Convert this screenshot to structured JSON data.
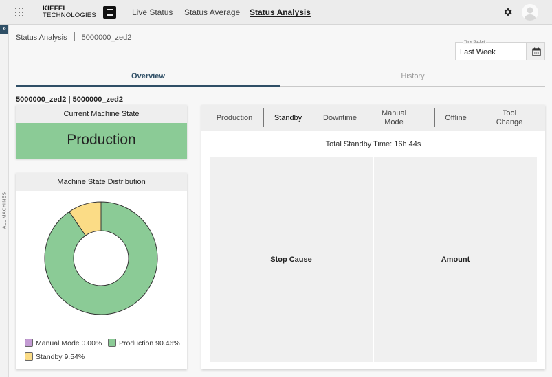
{
  "header": {
    "logo": {
      "line1": "KIEFEL",
      "line2": "TECHNOLOGIES"
    },
    "nav": [
      {
        "label": "Live Status",
        "active": false
      },
      {
        "label": "Status Average",
        "active": false
      },
      {
        "label": "Status Analysis",
        "active": true
      }
    ],
    "settings_icon": "gear-icon",
    "account_icon": "user-avatar-icon"
  },
  "sidebar": {
    "toggle": "»",
    "label": "ALL MACHINES"
  },
  "breadcrumb": {
    "parent": "Status Analysis",
    "current": "5000000_zed2"
  },
  "time_bucket": {
    "label": "Time Bucket",
    "value": "Last Week",
    "icon": "calendar-icon"
  },
  "tabs": [
    {
      "label": "Overview",
      "active": true
    },
    {
      "label": "History",
      "active": false
    }
  ],
  "machine_title": "5000000_zed2 | 5000000_zed2",
  "current_state": {
    "title": "Current Machine State",
    "value": "Production",
    "color": "#8bcb96"
  },
  "distribution": {
    "title": "Machine State Distribution",
    "legend": [
      {
        "label": "Manual Mode 0.00%",
        "color": "#c39bd3"
      },
      {
        "label": "Production 90.46%",
        "color": "#8bcb96"
      },
      {
        "label": "Standby 9.54%",
        "color": "#fbdc86"
      }
    ]
  },
  "chart_data": {
    "type": "pie",
    "donut": true,
    "categories": [
      "Manual Mode",
      "Production",
      "Standby"
    ],
    "values": [
      0.0,
      90.46,
      9.54
    ],
    "colors": [
      "#c39bd3",
      "#8bcb96",
      "#fbdc86"
    ],
    "title": "Machine State Distribution",
    "legend_position": "bottom"
  },
  "state_tabs": [
    {
      "label": "Production",
      "active": false
    },
    {
      "label": "Standby",
      "active": true
    },
    {
      "label": "Downtime",
      "active": false
    },
    {
      "label": "Manual Mode",
      "active": false
    },
    {
      "label": "Offline",
      "active": false
    },
    {
      "label": "Tool Change",
      "active": false
    }
  ],
  "standby": {
    "total": "Total Standby Time: 16h 44s",
    "columns": [
      "Stop Cause",
      "Amount"
    ]
  }
}
